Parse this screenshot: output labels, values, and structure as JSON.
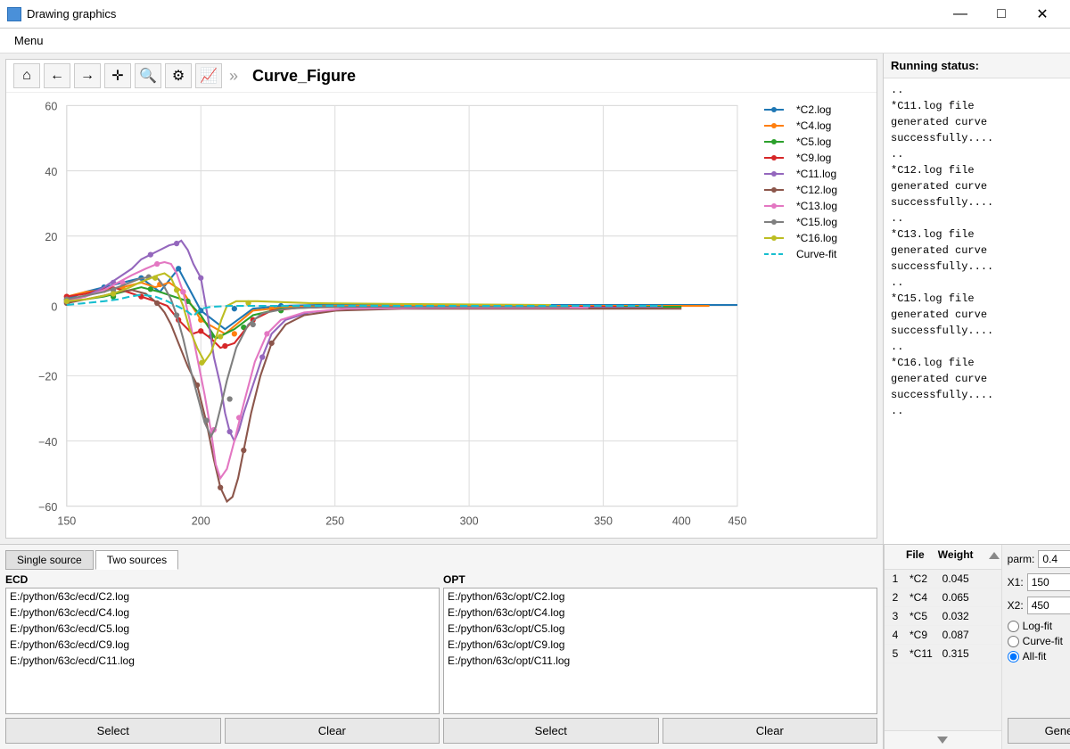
{
  "titleBar": {
    "icon": "□",
    "title": "Drawing graphics",
    "minimize": "—",
    "maximize": "□",
    "close": "✕"
  },
  "menuBar": {
    "items": [
      "Menu"
    ]
  },
  "toolbar": {
    "buttons": [
      "⌂",
      "←",
      "→",
      "✛",
      "🔍",
      "⚙",
      "📈"
    ],
    "separator": "»",
    "chartTitle": "Curve_Figure"
  },
  "legend": {
    "items": [
      {
        "label": "*C2.log",
        "color": "#1f77b4",
        "dash": false
      },
      {
        "label": "*C4.log",
        "color": "#ff7f0e",
        "dash": false
      },
      {
        "label": "*C5.log",
        "color": "#2ca02c",
        "dash": false
      },
      {
        "label": "*C9.log",
        "color": "#d62728",
        "dash": false
      },
      {
        "label": "*C11.log",
        "color": "#9467bd",
        "dash": false
      },
      {
        "label": "*C12.log",
        "color": "#8c564b",
        "dash": false
      },
      {
        "label": "*C13.log",
        "color": "#e377c2",
        "dash": false
      },
      {
        "label": "*C15.log",
        "color": "#7f7f7f",
        "dash": false
      },
      {
        "label": "*C16.log",
        "color": "#bcbd22",
        "dash": false
      },
      {
        "label": "Curve-fit",
        "color": "#17becf",
        "dash": true
      }
    ]
  },
  "statusPanel": {
    "title": "Running status:",
    "text": "..\n*C11.log file\ngenerated curve\nsuccessfully....\n..\n*C12.log file\ngenerated curve\nsuccessfully....\n..\n*C13.log file\ngenerated curve\nsuccessfully....\n..\n*C15.log file\ngenerated curve\nsuccessfully....\n..\n*C16.log file\ngenerated curve\nsuccessfully....\n.."
  },
  "tabs": {
    "items": [
      "Single source",
      "Two sources"
    ],
    "active": 1
  },
  "ecd": {
    "label": "ECD",
    "files": [
      "E:/python/63c/ecd/C2.log",
      "E:/python/63c/ecd/C4.log",
      "E:/python/63c/ecd/C5.log",
      "E:/python/63c/ecd/C9.log",
      "E:/python/63c/ecd/C11.log"
    ],
    "selectBtn": "Select",
    "clearBtn": "Clear"
  },
  "opt": {
    "label": "OPT",
    "files": [
      "E:/python/63c/opt/C2.log",
      "E:/python/63c/opt/C4.log",
      "E:/python/63c/opt/C5.log",
      "E:/python/63c/opt/C9.log",
      "E:/python/63c/opt/C11.log"
    ],
    "selectBtn": "Select",
    "clearBtn": "Clear"
  },
  "fileWeightTable": {
    "headers": [
      "",
      "File",
      "Weight",
      ""
    ],
    "rows": [
      {
        "num": "1",
        "file": "*C2",
        "weight": "0.045"
      },
      {
        "num": "2",
        "file": "*C4",
        "weight": "0.065"
      },
      {
        "num": "3",
        "file": "*C5",
        "weight": "0.032"
      },
      {
        "num": "4",
        "file": "*C9",
        "weight": "0.087"
      },
      {
        "num": "5",
        "file": "*C11",
        "weight": "0.315"
      }
    ]
  },
  "params": {
    "parmLabel": "parm:",
    "parmValue": "0.4",
    "x1Label": "X1:",
    "x1Value": "150",
    "x2Label": "X2:",
    "x2Value": "450",
    "fitOptions": [
      "Log-fit",
      "Curve-fit",
      "All-fit"
    ],
    "selectedFit": 2,
    "generateBtn": "Generate"
  }
}
